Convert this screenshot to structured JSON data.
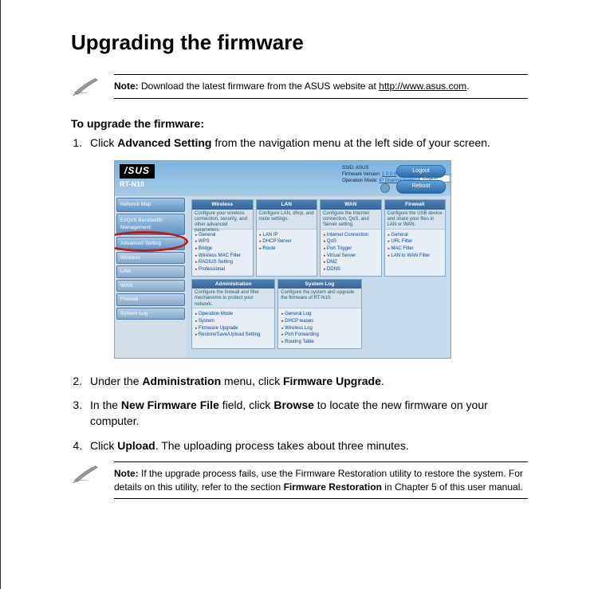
{
  "title": "Upgrading the firmware",
  "note1": {
    "label": "Note:",
    "text": " Download the latest firmware from the ASUS website at ",
    "link": "http://www.asus.com",
    "tail": "."
  },
  "intro": "To upgrade the firmware:",
  "steps": {
    "s1a": "Click ",
    "s1b": "Advanced Setting",
    "s1c": " from the navigation menu at the left side of your screen.",
    "s2a": "Under the ",
    "s2b": "Administration",
    "s2c": " menu, click ",
    "s2d": "Firmware Upgrade",
    "s2e": ".",
    "s3a": "In the ",
    "s3b": "New Firmware File",
    "s3c": " field, click ",
    "s3d": "Browse",
    "s3e": " to locate the new firmware on your computer.",
    "s4a": "Click ",
    "s4b": "Upload",
    "s4c": ". The uploading process takes about three minutes."
  },
  "note2": {
    "label": "Note:",
    "t1": " If the upgrade process fails, use the Firmware Restoration utility to restore the system. For details on this utility, refer to the section ",
    "bold": "Firmware Restoration",
    "t2": " in Chapter 5 of this user manual."
  },
  "router": {
    "brand": "/SUS",
    "model": "RT-N10",
    "top": {
      "ssid_lbl": "SSID:",
      "ssid": "ASUS",
      "fw_lbl": "Firmware Version:",
      "fw": "1.0.0.9",
      "op_lbl": "Operation Mode:",
      "op": "IP Sharing mode",
      "lang_lbl": "Language:",
      "lang": "English"
    },
    "buttons": {
      "logout": "Logout",
      "reboot": "Reboot"
    },
    "side": {
      "netmap": "Network Map",
      "ezqos": "EzQoS Bandwidth Management",
      "adv": "Advanced Setting",
      "wireless": "Wireless",
      "lan": "LAN",
      "wan": "WAN",
      "firewall": "Firewall",
      "syslog": "System Log"
    },
    "panels": {
      "wireless": {
        "h": "Wireless",
        "desc": "Configure your wireless connection, security, and other advanced parameters.",
        "items": [
          "General",
          "WPS",
          "Bridge",
          "Wireless MAC Filter",
          "RADIUS Setting",
          "Professional"
        ]
      },
      "lan": {
        "h": "LAN",
        "desc": "Configure LAN, dhcp, and route settings.",
        "items": [
          "LAN IP",
          "DHCP Server",
          "Route"
        ]
      },
      "wan": {
        "h": "WAN",
        "desc": "Configure the Internet connection, QoS, and Server setting.",
        "items": [
          "Internet Connection",
          "QoS",
          "Port Trigger",
          "Virtual Server",
          "DMZ",
          "DDNS"
        ]
      },
      "firewall": {
        "h": "Firewall",
        "desc": "Configure the USB device and share your files in LAN or WAN.",
        "items": [
          "General",
          "URL Filter",
          "MAC Filter",
          "LAN to WAN Filter"
        ]
      },
      "admin": {
        "h": "Administration",
        "desc": "Configure the firewall and filter mechanisms to protect your network.",
        "items": [
          "Operation Mode",
          "System",
          "Firmware Upgrade",
          "Restore/Save/Upload Setting"
        ]
      },
      "syslog": {
        "h": "System Log",
        "desc": "Configure the system and upgrade the firmware of RT-N10.",
        "items": [
          "General Log",
          "DHCP leases",
          "Wireless Log",
          "Port Forwarding",
          "Routing Table"
        ]
      }
    }
  }
}
